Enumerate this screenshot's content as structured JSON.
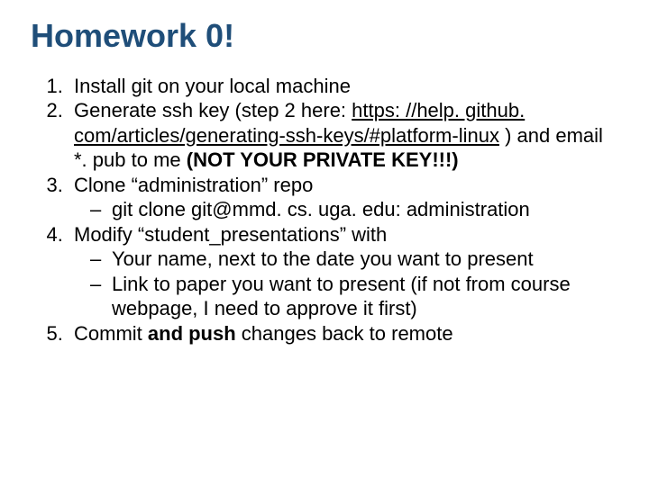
{
  "title": "Homework 0!",
  "items": {
    "i1": "Install git on your local machine",
    "i2_pre": "Generate ssh key (step 2 here: ",
    "i2_link": "https: //help. github. com/articles/generating-ssh-keys/#platform-linux",
    "i2_mid": " ) and email *. pub to me ",
    "i2_bold": "(NOT YOUR PRIVATE KEY!!!)",
    "i3": "Clone “administration” repo",
    "i3_sub1": "git clone git@mmd. cs. uga. edu: administration",
    "i4": "Modify “student_presentations” with",
    "i4_sub1": "Your name, next to the date you want to present",
    "i4_sub2": "Link to paper you want to present (if not from course webpage, I need to approve it first)",
    "i5_a": "Commit ",
    "i5_b": "and push",
    "i5_c": " changes back to remote"
  }
}
